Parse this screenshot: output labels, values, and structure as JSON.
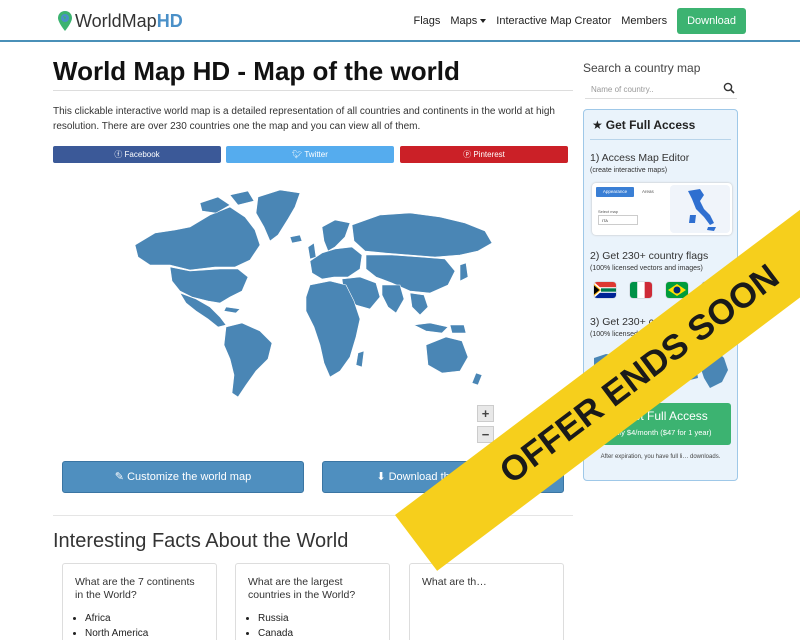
{
  "nav": {
    "logo_prefix": "WorldMap",
    "logo_suffix": "HD",
    "links": [
      "Flags",
      "Maps",
      "Interactive Map Creator",
      "Members"
    ],
    "download_label": "Download"
  },
  "main": {
    "title": "World Map HD - Map of the world",
    "intro": "This clickable interactive world map is a detailed representation of all countries and continents in the world at high resolution. There are over 230 countries one the map and you can view all of them.",
    "share": {
      "facebook": "Facebook",
      "twitter": "Twitter",
      "pinterest": "Pinterest"
    },
    "zoom_in": "+",
    "zoom_out": "−",
    "customize_label": "Customize the world map",
    "download_label": "Download the world map"
  },
  "facts": {
    "title": "Interesting Facts About the World",
    "cards": [
      {
        "question": "What are the 7 continents in the World?",
        "items": [
          "Africa",
          "North America"
        ]
      },
      {
        "question": "What are the largest countries in the World?",
        "items": [
          "Russia",
          "Canada"
        ]
      },
      {
        "question": "What are th…",
        "items": []
      }
    ]
  },
  "sidebar": {
    "search_title": "Search a country map",
    "search_placeholder": "Name of country..",
    "promo_title": "Get Full Access",
    "step1_title": "1) Access Map Editor",
    "step1_sub": "(create interactive maps)",
    "editor_tab_active": "Appearance",
    "editor_tab_other": "Areas",
    "editor_select_label": "Select map",
    "editor_select_value": "ITA",
    "step2_title": "2) Get 230+ country flags",
    "step2_sub": "(100% licensed vectors and images)",
    "step3_title": "3) Get 230+ country maps",
    "step3_sub": "(100% licensed vectors and images)",
    "access_button": "Get Full Access",
    "access_price": "Only $4/month ($47 for 1 year)",
    "expire_note": "After expiration, you have full li… downloads."
  },
  "ribbon": {
    "text": "OFFER ENDS SOON"
  },
  "colors": {
    "accent_green": "#3cb371",
    "map_blue": "#4a86b5",
    "button_blue": "#4f8fbf",
    "facebook": "#3b5998",
    "twitter": "#55acee",
    "pinterest": "#cb2027",
    "ribbon": "#f6cf1c"
  }
}
